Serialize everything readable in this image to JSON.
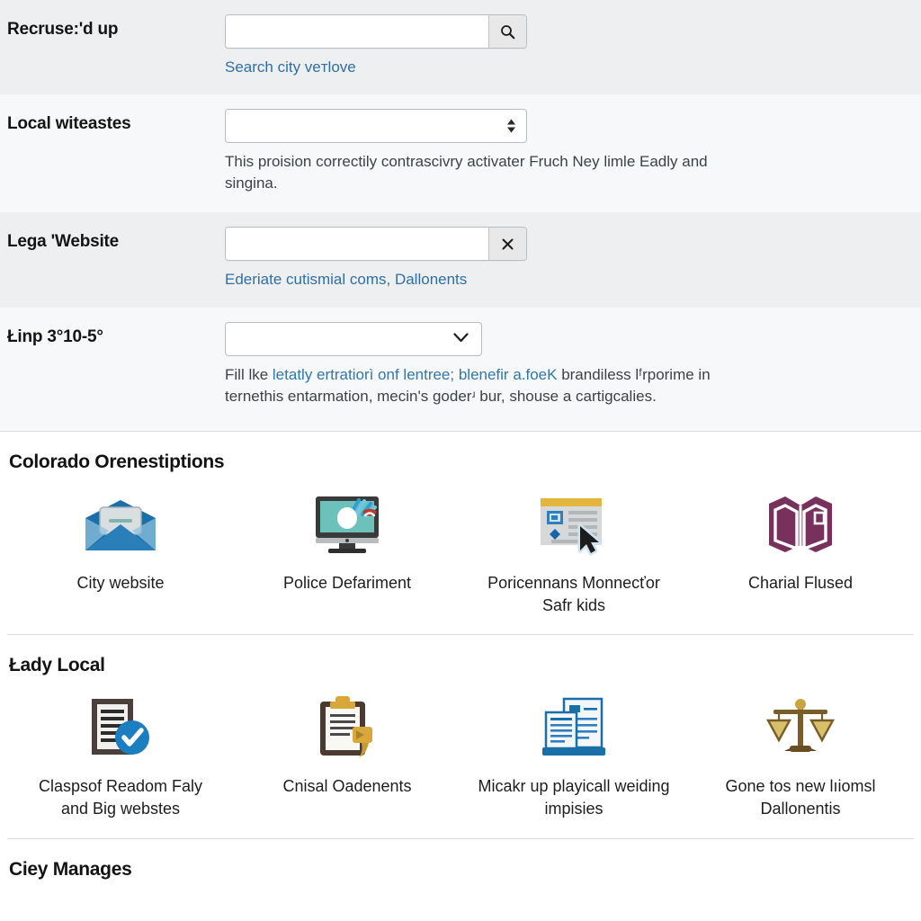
{
  "form": {
    "rows": [
      {
        "label": "Recruse:'d up",
        "control": "search-input",
        "input_value": "",
        "input_placeholder": "",
        "button_icon": "search-icon",
        "helper": "Search city veᴛlove",
        "helper_is_link": true
      },
      {
        "label": "Local witeastes",
        "control": "stepper-select",
        "input_value": "",
        "helper": "This proision correctily contrascivry activater Fruch Ney limle Eadly and singina.",
        "helper_is_link": false
      },
      {
        "label": "Lega 'Website",
        "control": "clear-input",
        "input_value": "",
        "button_icon": "close-icon",
        "helper": "Ederiate cutismial coms, Dallonents",
        "helper_is_link": true
      },
      {
        "label": "Łinp 3°10-5°",
        "control": "chevron-select",
        "input_value": "",
        "helper_part1": "Fill lke ",
        "helper_link1": "letatly ertratiorì onf lentree; blenefir a.foeK",
        "helper_part2": " brandiless lᶠrporime in ternethis entarmation, mecin's goderʴ bur, shouse a cartigcalies."
      }
    ]
  },
  "sections": [
    {
      "title": "Colorado Orenestiptions",
      "items": [
        {
          "icon": "envelope-open-icon",
          "label": "City website"
        },
        {
          "icon": "monitor-icon",
          "label": "Police Defariment"
        },
        {
          "icon": "webpage-cursor-icon",
          "label": "Poricennans Monnecťor Safr kids"
        },
        {
          "icon": "open-book-icon",
          "label": "Charial Flused"
        }
      ]
    },
    {
      "title": "Łady Local",
      "items": [
        {
          "icon": "document-check-icon",
          "label": "Claspsof Readom Faly and Big webstes"
        },
        {
          "icon": "clipboard-icon",
          "label": "Cnisal Oadenents"
        },
        {
          "icon": "documents-stack-icon",
          "label": "Micakr up playicall weiding impisies"
        },
        {
          "icon": "scales-icon",
          "label": "Gone tos new lıiomsl Dallonentis"
        }
      ]
    },
    {
      "title": "Ciey Manages",
      "items": []
    }
  ],
  "colors": {
    "link": "#3276ad",
    "row_shade": "#eeeff1",
    "row_plain": "#f7f8f9",
    "envelope_blue": "#1a6fa8",
    "monitor_teal": "#6cc2bb",
    "webpage_yellow": "#e3b53c",
    "book_purple": "#77315c",
    "check_blue": "#1a7ec0",
    "clipboard_gold": "#d8a93a",
    "documents_blue": "#1a6fa8",
    "scales_gold": "#a8832f"
  }
}
